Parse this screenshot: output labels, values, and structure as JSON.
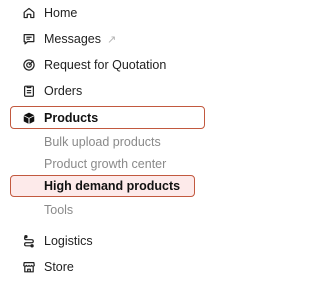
{
  "nav": {
    "home": {
      "label": "Home",
      "icon": "home-icon"
    },
    "messages": {
      "label": "Messages",
      "external": "↗",
      "icon": "chat-icon"
    },
    "rfq": {
      "label": "Request for Quotation",
      "icon": "target-icon"
    },
    "orders": {
      "label": "Orders",
      "icon": "clipboard-icon"
    },
    "products": {
      "label": "Products",
      "icon": "box-icon",
      "children": [
        {
          "label": "Bulk upload products"
        },
        {
          "label": "Product growth center"
        },
        {
          "label": "High demand products"
        },
        {
          "label": "Tools"
        }
      ]
    },
    "logistics": {
      "label": "Logistics",
      "icon": "logistics-icon"
    },
    "store": {
      "label": "Store",
      "icon": "store-icon"
    }
  },
  "colors": {
    "highlight_border": "#c2593f",
    "highlight_fill": "#fdeaea"
  }
}
